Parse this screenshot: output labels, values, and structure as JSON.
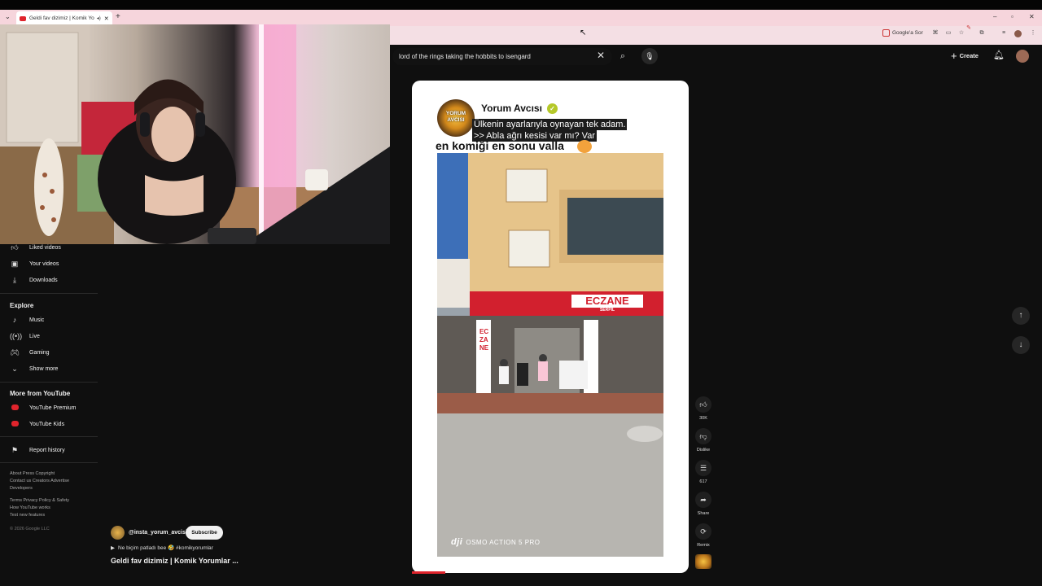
{
  "browser": {
    "tab_title": "Geldi fav dizimiz | Komik Yo",
    "new_tab_symbol": "+",
    "google_translate_label": "Google'a Sor"
  },
  "header": {
    "search_query": "lord of the rings taking the hobbits to isengard",
    "create_label": "Create"
  },
  "sidebar": {
    "you_items": [
      {
        "label": "Liked videos",
        "icon": "thumbs-up-icon"
      },
      {
        "label": "Your videos",
        "icon": "play-square-icon"
      },
      {
        "label": "Downloads",
        "icon": "download-icon"
      }
    ],
    "explore_title": "Explore",
    "explore_items": [
      {
        "label": "Music",
        "icon": "music-note-icon"
      },
      {
        "label": "Live",
        "icon": "live-icon"
      },
      {
        "label": "Gaming",
        "icon": "gamepad-icon"
      },
      {
        "label": "Show more",
        "icon": "chevron-down-icon"
      }
    ],
    "more_title": "More from YouTube",
    "more_items": [
      {
        "label": "YouTube Premium"
      },
      {
        "label": "YouTube Kids"
      }
    ],
    "report_history": "Report history",
    "footer_line1": "About  Press  Copyright",
    "footer_line2": "Contact us  Creators  Advertise",
    "footer_line3": "Developers",
    "footer_line4": "Terms  Privacy  Policy & Safety",
    "footer_line5": "How YouTube works",
    "footer_line6": "Test new features",
    "copyright": "© 2026 Google LLC"
  },
  "short": {
    "channel_handle": "@insta_yorum_avcisi",
    "subscribe_label": "Subscribe",
    "music_line": "Ne biçim patladı bee 🤣 #komikyorumlar",
    "title": "Geldi fav dizimiz | Komik Yorumlar ...",
    "caption_avatar_text": "YORUM AVCISI",
    "caption_name": "Yorum Avcısı",
    "caption_line1": "Ülkenin ayarlarıyla oynayan tek adam.",
    "caption_line2": ">> Abla ağrı kesisi var mı? Var",
    "caption_bold": "en komiği en sonu valla",
    "pharmacy_sign": "ECZANE",
    "pharmacy_sub": "SERPİL",
    "pharmacy_vertical": "ECZANE",
    "watermark": "OSMO ACTION 5 PRO",
    "dji_logo": "dji"
  },
  "actions": {
    "likes": "30K",
    "dislike_label": "Dislike",
    "comments": "617",
    "share_label": "Share",
    "remix_label": "Remix"
  },
  "progress_fraction": 0.12
}
